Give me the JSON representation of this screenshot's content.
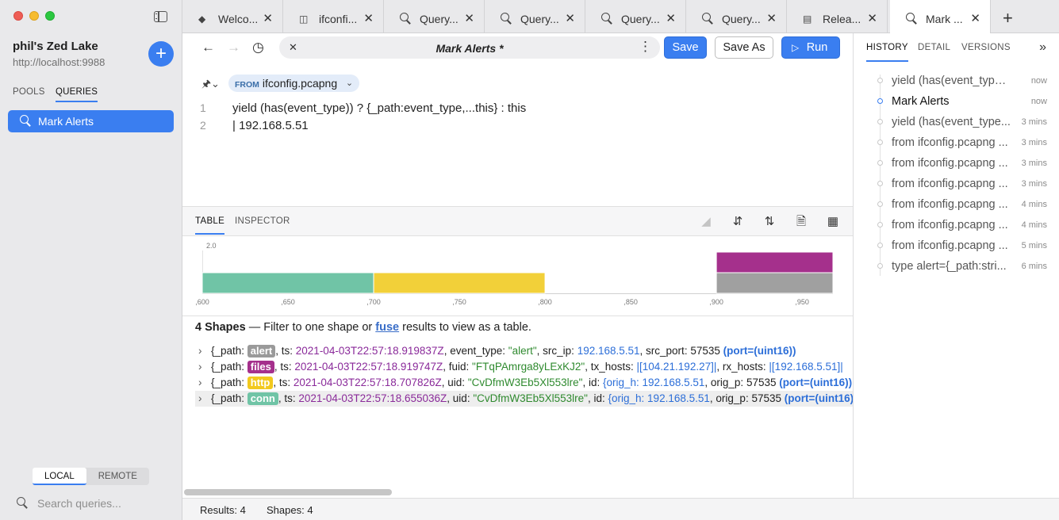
{
  "sidebar": {
    "lake_name": "phil's Zed Lake",
    "lake_url": "http://localhost:9988",
    "add_label": "+",
    "tabs": [
      {
        "label": "POOLS"
      },
      {
        "label": "QUERIES"
      }
    ],
    "items": [
      {
        "label": "Mark Alerts"
      }
    ],
    "segments": [
      {
        "label": "LOCAL"
      },
      {
        "label": "REMOTE"
      }
    ],
    "search_placeholder": "Search queries..."
  },
  "tabs": [
    {
      "label": "Welco...",
      "icon": "zed-logo-icon"
    },
    {
      "label": "ifconfi...",
      "icon": "pool-icon"
    },
    {
      "label": "Query...",
      "icon": "search-icon"
    },
    {
      "label": "Query...",
      "icon": "search-icon"
    },
    {
      "label": "Query...",
      "icon": "search-icon"
    },
    {
      "label": "Query...",
      "icon": "search-icon"
    },
    {
      "label": "Relea...",
      "icon": "document-icon"
    },
    {
      "label": "Mark ...",
      "icon": "search-icon"
    }
  ],
  "toolbar": {
    "query_title": "Mark Alerts *",
    "save_label": "Save",
    "save_as_label": "Save As",
    "run_label": "Run"
  },
  "editor": {
    "from_keyword": "FROM",
    "pool": "ifconfig.pcapng",
    "lines": [
      {
        "num": "1",
        "text": "yield (has(event_type)) ? {_path:event_type,...this} : this"
      },
      {
        "num": "2",
        "text": "| 192.168.5.51"
      }
    ]
  },
  "results": {
    "tabs": [
      {
        "label": "TABLE"
      },
      {
        "label": "INSPECTOR"
      }
    ]
  },
  "chart_data": {
    "type": "bar",
    "stacked": true,
    "ylim": [
      0,
      2
    ],
    "y_tick_labels": [
      "2.0"
    ],
    "x_tick_labels": [
      ",600",
      ",650",
      ",700",
      ",750",
      ",800",
      ",850",
      ",900",
      ",950"
    ],
    "x_range": [
      0.6,
      0.968
    ],
    "bars": [
      {
        "x0": 0.6,
        "x1": 0.7,
        "value": 1,
        "color": "#70c4a6"
      },
      {
        "x0": 0.7,
        "x1": 0.8,
        "value": 1,
        "color": "#f2d039"
      },
      {
        "x0": 0.9,
        "x1": 0.968,
        "value": 1,
        "color": "#a0a0a0"
      },
      {
        "x0": 0.9,
        "x1": 0.968,
        "value": 1,
        "base": 1,
        "color": "#a5308c"
      }
    ]
  },
  "shapes_bar": {
    "count": "4 Shapes",
    "text1": " — Filter to one shape or ",
    "link": "fuse",
    "text2": " results to view as a table."
  },
  "records": [
    {
      "path": "alert",
      "color": "#9a9a9a",
      "ts": "2021-04-03T22:57:18.919837Z",
      "fields": [
        {
          "k": "event_type",
          "v": "\"alert\"",
          "t": "str"
        },
        {
          "k": "src_ip",
          "v": "192.168.5.51",
          "t": "ip"
        },
        {
          "k": "src_port",
          "v": "57535",
          "t": "num"
        }
      ],
      "tail": "(port=(uint16))"
    },
    {
      "path": "files",
      "color": "#a5308c",
      "ts": "2021-04-03T22:57:18.919747Z",
      "fields": [
        {
          "k": "fuid",
          "v": "\"FTqPAmrga8yLExKJ2\"",
          "t": "str"
        },
        {
          "k": "tx_hosts",
          "v": "|[104.21.192.27]|",
          "t": "ip"
        },
        {
          "k": "rx_hosts",
          "v": "|[192.168.5.51]|",
          "t": "ip"
        }
      ],
      "tail": ""
    },
    {
      "path": "http",
      "color": "#f2c91e",
      "ts": "2021-04-03T22:57:18.707826Z",
      "fields": [
        {
          "k": "uid",
          "v": "\"CvDfmW3Eb5Xl553lre\"",
          "t": "str"
        },
        {
          "k": "id",
          "v": "{orig_h: 192.168.5.51",
          "t": "mix"
        },
        {
          "k": "orig_p",
          "v": "57535",
          "t": "num"
        }
      ],
      "tail": "(port=(uint16))"
    },
    {
      "path": "conn",
      "color": "#70c4a6",
      "ts": "2021-04-03T22:57:18.655036Z",
      "fields": [
        {
          "k": "uid",
          "v": "\"CvDfmW3Eb5Xl553lre\"",
          "t": "str"
        },
        {
          "k": "id",
          "v": "{orig_h: 192.168.5.51",
          "t": "mix"
        },
        {
          "k": "orig_p",
          "v": "57535",
          "t": "num"
        }
      ],
      "tail": "(port=(uint16))"
    }
  ],
  "status": {
    "results": "Results: 4",
    "shapes": "Shapes: 4"
  },
  "right_panel": {
    "tabs": [
      {
        "label": "HISTORY"
      },
      {
        "label": "DETAIL"
      },
      {
        "label": "VERSIONS"
      }
    ],
    "history": [
      {
        "text": "yield (has(event_type))...",
        "time": "now"
      },
      {
        "text": "Mark Alerts",
        "time": "now"
      },
      {
        "text": "yield (has(event_type...",
        "time": "3 mins"
      },
      {
        "text": "from ifconfig.pcapng ...",
        "time": "3 mins"
      },
      {
        "text": "from ifconfig.pcapng ...",
        "time": "3 mins"
      },
      {
        "text": "from ifconfig.pcapng ...",
        "time": "3 mins"
      },
      {
        "text": "from ifconfig.pcapng ...",
        "time": "4 mins"
      },
      {
        "text": "from ifconfig.pcapng ...",
        "time": "4 mins"
      },
      {
        "text": "from ifconfig.pcapng ...",
        "time": "5 mins"
      },
      {
        "text": "type alert={_path:stri...",
        "time": "6 mins"
      }
    ]
  }
}
